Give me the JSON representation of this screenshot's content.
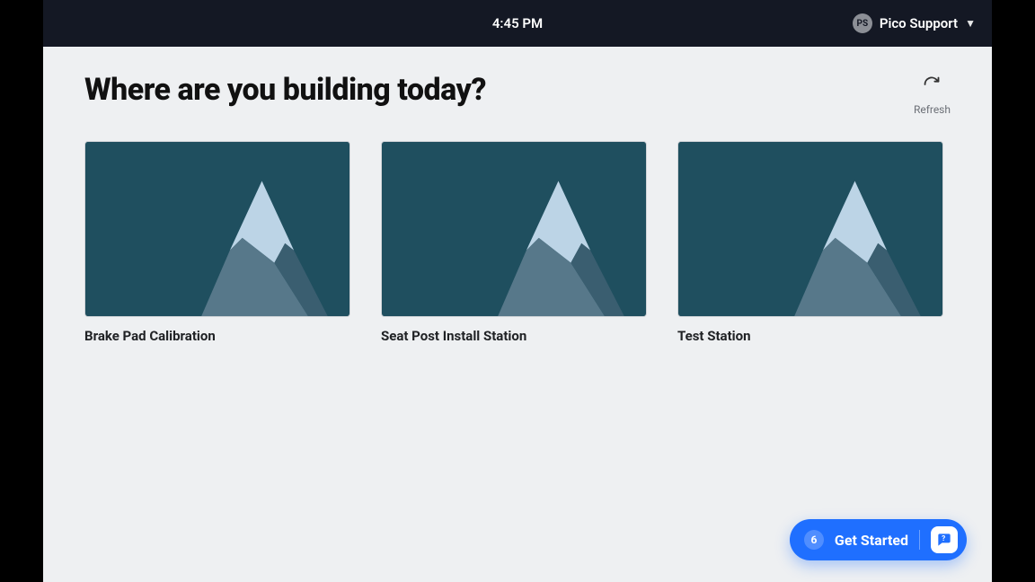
{
  "topbar": {
    "time": "4:45 PM",
    "user": {
      "initials": "PS",
      "name": "Pico Support"
    }
  },
  "page": {
    "title": "Where are you building today?",
    "refresh_label": "Refresh"
  },
  "cards": [
    {
      "title": "Brake Pad Calibration"
    },
    {
      "title": "Seat Post Install Station"
    },
    {
      "title": "Test Station"
    }
  ],
  "help": {
    "count": "6",
    "label": "Get Started"
  }
}
